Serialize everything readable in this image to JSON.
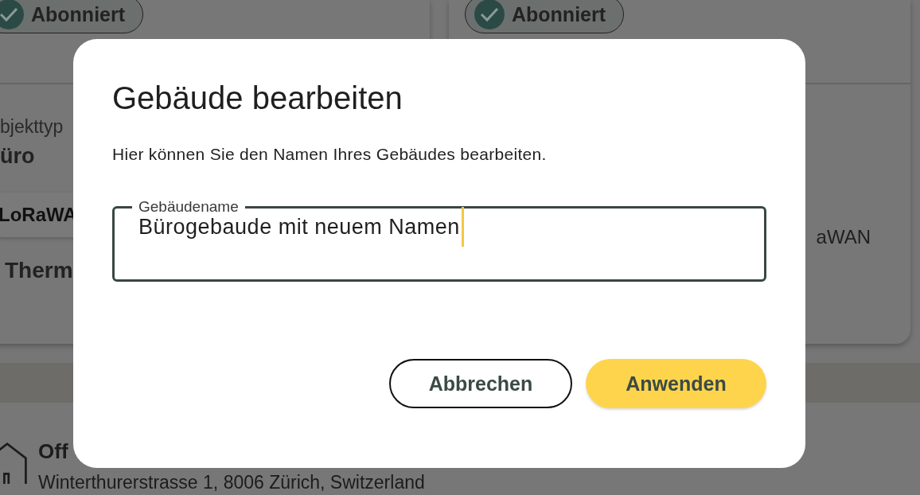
{
  "background": {
    "cards": [
      {
        "chip": {
          "label": "Abonniert",
          "checked": true
        },
        "type_label": "bjekttyp",
        "type_value": "üro",
        "logo": "LoRaWA",
        "sensor": "Therm"
      },
      {
        "chip": {
          "label": "Abonniert",
          "checked": true
        },
        "network": "aWAN"
      }
    ],
    "building": {
      "name": "Off",
      "address": "Winterthurerstrasse 1, 8006 Zürich, Switzerland"
    }
  },
  "dialog": {
    "title": "Gebäude bearbeiten",
    "description": "Hier können Sie den Namen Ihres Gebäudes bearbeiten.",
    "field": {
      "label": "Gebäudename",
      "value": "Bürogebaude mit neuem Namen",
      "focused": true
    },
    "buttons": [
      {
        "label": "Abbrechen",
        "kind": "outlined"
      },
      {
        "label": "Anwenden",
        "kind": "filled"
      }
    ]
  }
}
